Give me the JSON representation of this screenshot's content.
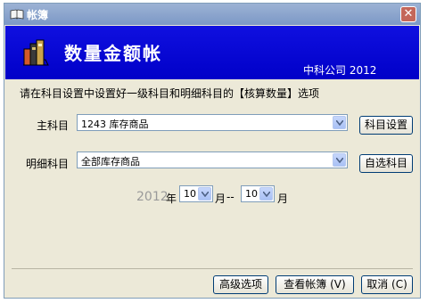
{
  "window": {
    "title": "帐簿",
    "close_glyph": "✕"
  },
  "banner": {
    "title": "数量金额帐",
    "subtitle": "中科公司 2012"
  },
  "instruction": "请在科目设置中设置好一级科目和明细科目的【核算数量】选项",
  "main_subject": {
    "label": "主科目",
    "value": "1243 库存商品",
    "button": "科目设置"
  },
  "detail_subject": {
    "label": "明细科目",
    "value": "全部库存商品",
    "button": "自选科目"
  },
  "period": {
    "year": "2012",
    "year_unit": "年",
    "from_month": "10",
    "month_unit": "月",
    "separator": "--",
    "to_month": "10",
    "to_month_unit": "月"
  },
  "footer": {
    "advanced": "高级选项",
    "view": "查看帐簿 (V)",
    "cancel": "取消 (C)"
  },
  "colors": {
    "banner": "#0000c8",
    "titlebar": "#7c98c6",
    "dialog_bg": "#ece9d8"
  }
}
